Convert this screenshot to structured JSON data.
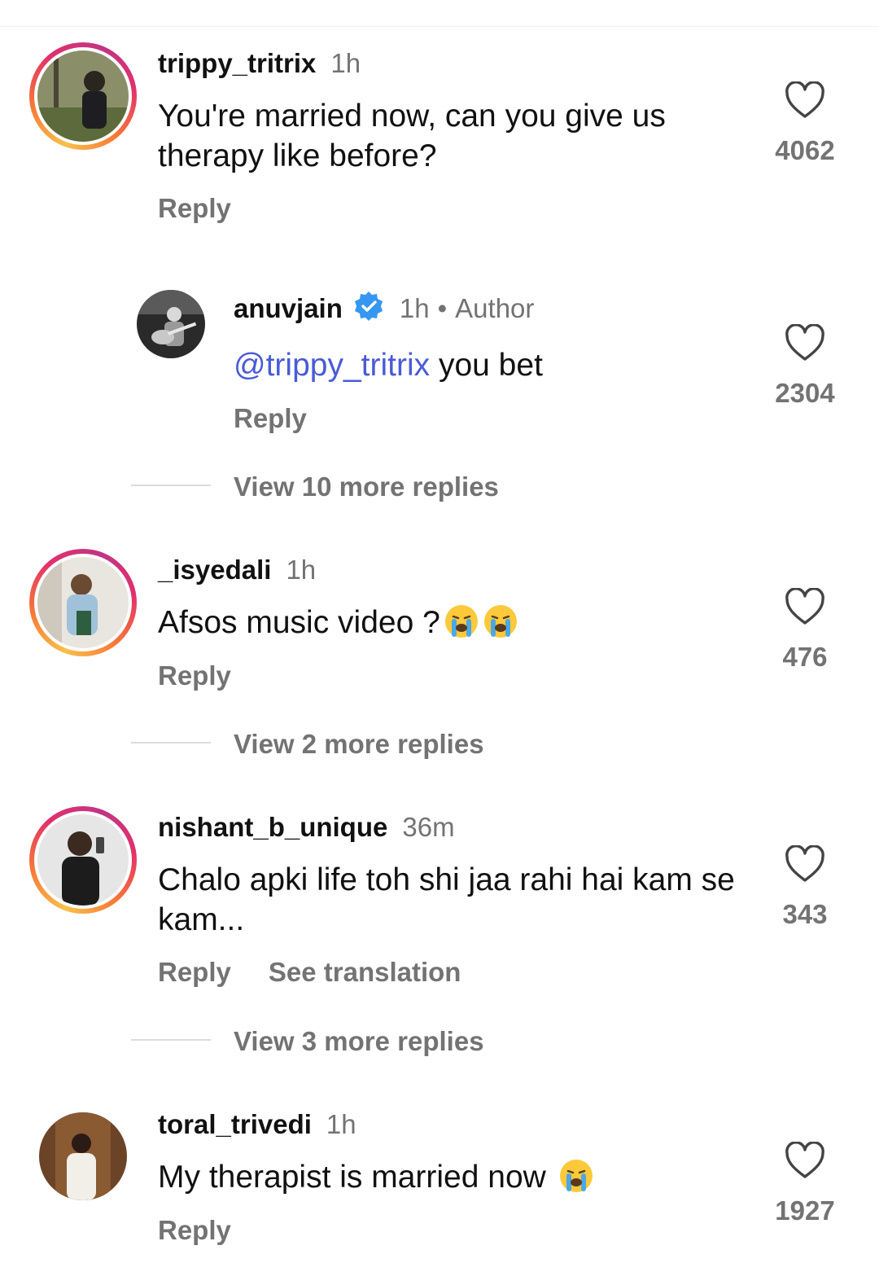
{
  "comments": [
    {
      "username": "trippy_tritrix",
      "time": "1h",
      "text": "You're married now, can you give us therapy like before?",
      "reply": "Reply",
      "likes": "4062"
    },
    {
      "username": "anuvjain",
      "time": "1h",
      "author_tag": "Author",
      "mention": "@trippy_tritrix",
      "text": "you bet",
      "reply": "Reply",
      "likes": "2304"
    },
    {
      "view_more": "View 10 more replies"
    },
    {
      "username": "_isyedali",
      "time": "1h",
      "text": "Afsos music video ?",
      "reply": "Reply",
      "likes": "476"
    },
    {
      "view_more": "View 2 more replies"
    },
    {
      "username": "nishant_b_unique",
      "time": "36m",
      "text": "Chalo apki life toh shi jaa rahi hai kam se kam...",
      "reply": "Reply",
      "translate": "See translation",
      "likes": "343"
    },
    {
      "view_more": "View 3 more replies"
    },
    {
      "username": "toral_trivedi",
      "time": "1h",
      "text": "My therapist is married now",
      "reply": "Reply",
      "likes": "1927"
    }
  ],
  "icons": {
    "like": "heart-icon",
    "verified": "verified-badge-icon",
    "emoji": "loudly-crying-face-emoji"
  },
  "colors": {
    "mention": "#4a5bd6",
    "muted": "#737373",
    "verified": "#3797f0"
  }
}
